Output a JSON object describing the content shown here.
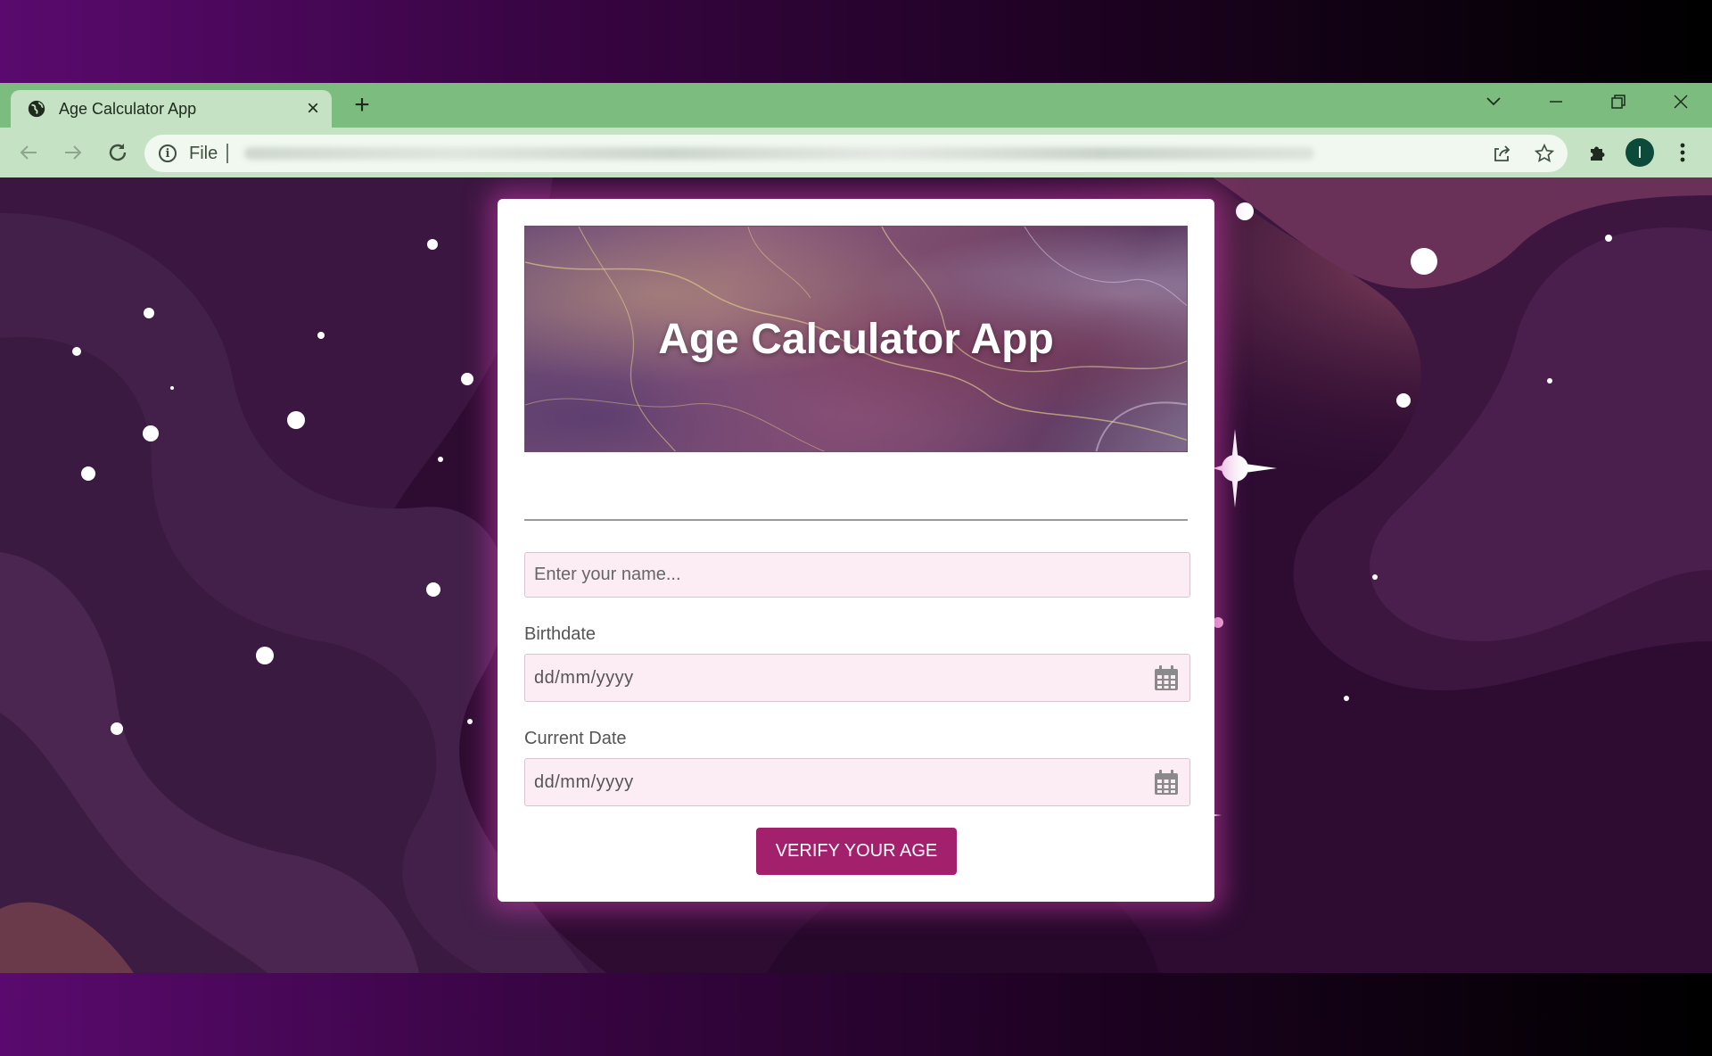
{
  "browser": {
    "tab_title": "Age Calculator App",
    "new_tab_symbol": "+",
    "url_scheme": "File",
    "icons": {
      "favicon": "globe-icon",
      "tab_close": "close-icon",
      "new_tab": "plus-icon",
      "tab_search": "chevron-down-icon",
      "minimize": "minimize-icon",
      "restore": "restore-icon",
      "close_window": "close-icon",
      "back": "arrow-left-icon",
      "forward": "arrow-right-icon",
      "reload": "reload-icon",
      "site_info": "info-icon",
      "share": "share-icon",
      "bookmark": "star-icon",
      "extensions": "puzzle-icon",
      "menu": "more-vertical-icon"
    },
    "profile_initial": "I",
    "colors": {
      "tabbar": "#7cbd7f",
      "toolbar": "#c5e3c4",
      "avatar": "#0c4a3a"
    }
  },
  "app": {
    "title": "Age Calculator App",
    "name_placeholder": "Enter your name...",
    "birthdate_label": "Birthdate",
    "birthdate_placeholder": "dd/mm/yyyy",
    "current_date_label": "Current Date",
    "current_date_placeholder": "dd/mm/yyyy",
    "verify_button": "VERIFY YOUR AGE",
    "icons": {
      "calendar": "calendar-icon"
    },
    "colors": {
      "accent": "#a3206d",
      "field_bg": "#fcecf4",
      "card": "#ffffff",
      "page_bg": "#2e0c32"
    }
  }
}
